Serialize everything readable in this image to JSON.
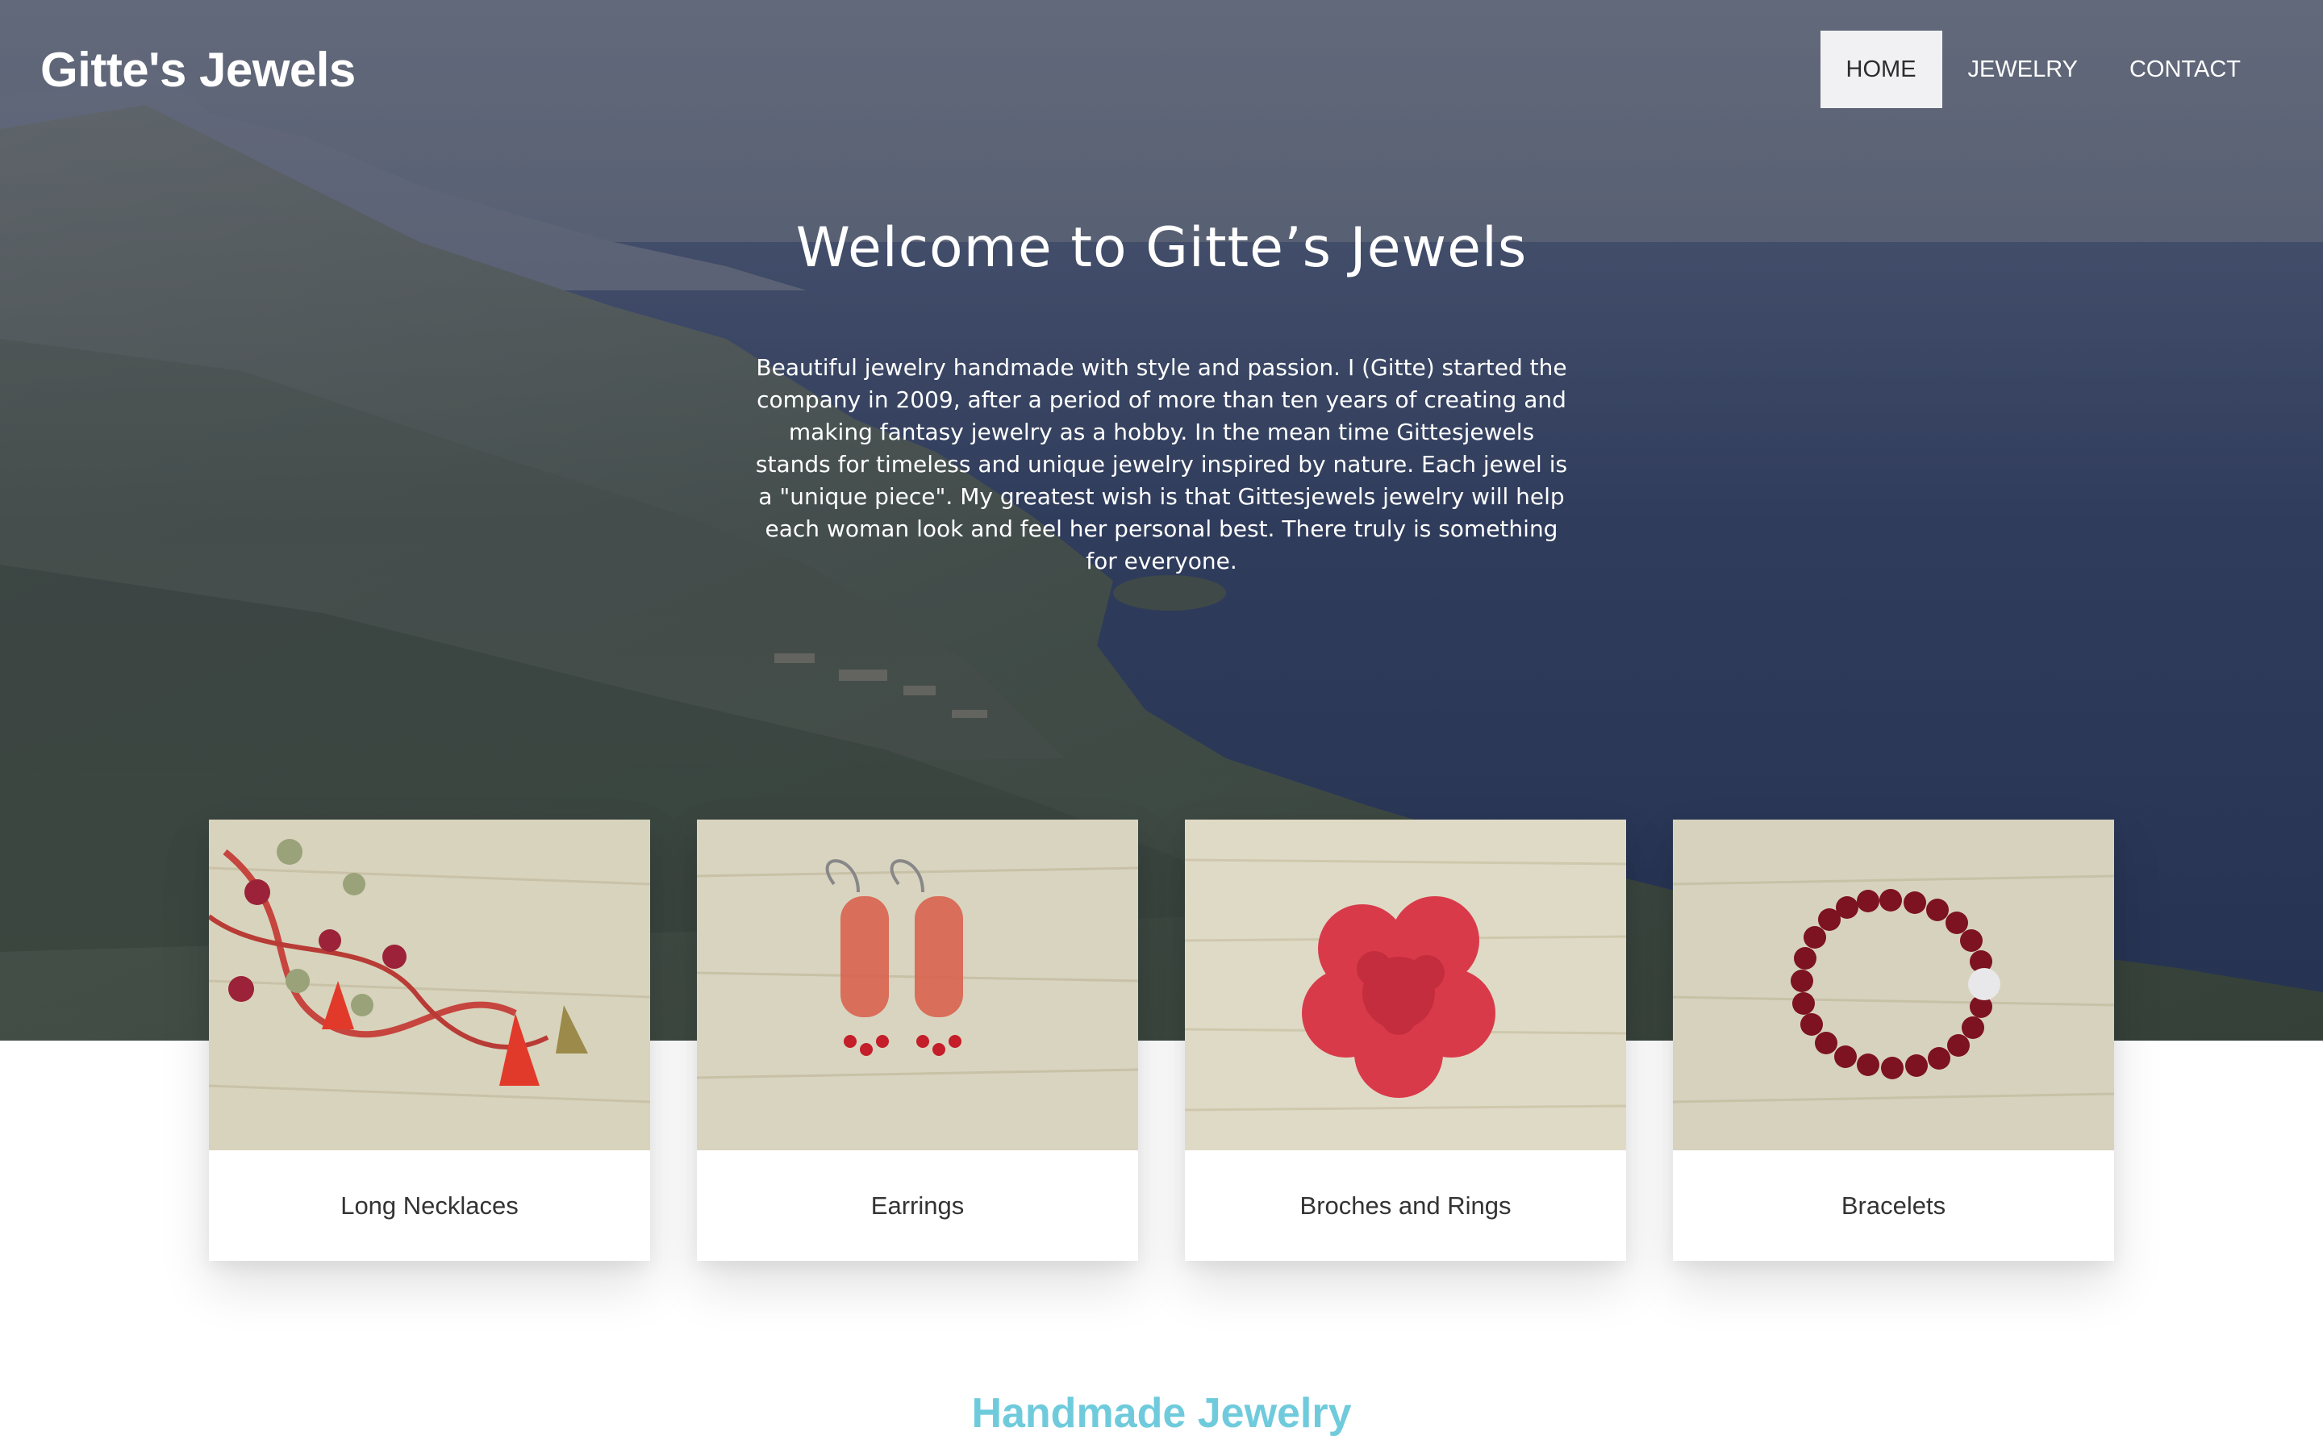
{
  "site": {
    "brand": "Gitte's Jewels"
  },
  "nav": [
    {
      "label": "HOME",
      "active": true
    },
    {
      "label": "JEWELRY",
      "active": false
    },
    {
      "label": "CONTACT",
      "active": false
    }
  ],
  "hero": {
    "title": "Welcome to Gitte’s Jewels",
    "text": "Beautiful jewelry handmade with style and passion. I (Gitte) started the company in 2009, after a period of more than ten years of creating and making fantasy jewelry as a hobby. In the mean time Gittesjewels stands for timeless and unique jewelry inspired by nature. Each jewel is a \"unique piece\". My greatest wish is that Gittesjewels jewelry will help each woman look and feel her personal best. There truly is something for everyone."
  },
  "categories": [
    {
      "label": "Long Necklaces"
    },
    {
      "label": "Earrings"
    },
    {
      "label": "Broches and Rings"
    },
    {
      "label": "Bracelets"
    }
  ],
  "section": {
    "title": "Handmade Jewelry"
  },
  "colors": {
    "accent": "#6fcbdc",
    "nav_active_bg": "#f1f1f3",
    "text_dark": "#333333"
  }
}
